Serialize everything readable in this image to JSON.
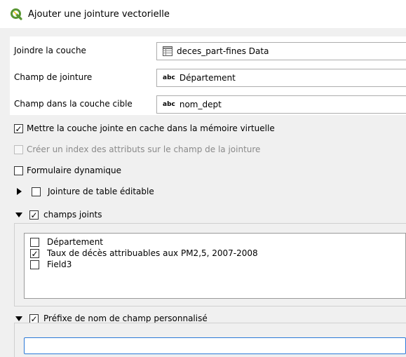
{
  "window": {
    "title": "Ajouter une jointure vectorielle",
    "icon": "qgis-logo-icon",
    "accent_color": "#589632"
  },
  "fields": {
    "join_layer": {
      "label": "Joindre la couche",
      "value": "deces_part-fines Data",
      "icon": "table-icon"
    },
    "join_field": {
      "label": "Champ de jointure",
      "value": "Département",
      "icon_text": "abc"
    },
    "target_field": {
      "label": "Champ dans la couche cible",
      "value": "nom_dept",
      "icon_text": "abc"
    }
  },
  "options": {
    "cache": {
      "label": "Mettre la couche jointe en cache dans la mémoire virtuelle",
      "checked": true,
      "enabled": true
    },
    "index": {
      "label": "Créer un index des attributs sur le champ de la jointure",
      "checked": false,
      "enabled": false
    },
    "dynamic_form": {
      "label": "Formulaire dynamique",
      "checked": false,
      "enabled": true
    }
  },
  "groups": {
    "editable": {
      "label": "Jointure de table éditable",
      "checked": false,
      "expanded": false
    },
    "joined_fields": {
      "label": "champs joints",
      "checked": true,
      "expanded": true,
      "items": [
        {
          "label": "Département",
          "checked": false
        },
        {
          "label": "Taux de décès attribuables aux PM2,5, 2007-2008",
          "checked": true
        },
        {
          "label": "Field3",
          "checked": false
        }
      ]
    },
    "prefix": {
      "label": "Préfixe de nom de champ personnalisé",
      "checked": true,
      "expanded": true,
      "value": ""
    }
  },
  "symbols": {
    "check": "✓"
  }
}
